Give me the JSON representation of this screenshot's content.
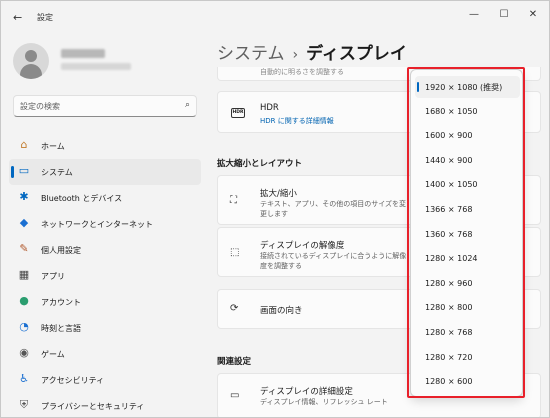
{
  "window": {
    "title": "設定",
    "back_icon": "←",
    "minimize": "—",
    "maximize": "☐",
    "close": "✕"
  },
  "search": {
    "placeholder": "設定の検索",
    "icon": "⌕"
  },
  "sidebar": {
    "items": [
      {
        "label": "ホーム",
        "icon": "⌂",
        "color": "#c27b2c"
      },
      {
        "label": "システム",
        "icon": "▭",
        "color": "#0067c0"
      },
      {
        "label": "Bluetooth とデバイス",
        "icon": "✱",
        "color": "#0067c0"
      },
      {
        "label": "ネットワークとインターネット",
        "icon": "◆",
        "color": "#1a6fd1"
      },
      {
        "label": "個人用設定",
        "icon": "✎",
        "color": "#b0572a"
      },
      {
        "label": "アプリ",
        "icon": "▦",
        "color": "#444444"
      },
      {
        "label": "アカウント",
        "icon": "●",
        "color": "#2a9d6f"
      },
      {
        "label": "時刻と言語",
        "icon": "◔",
        "color": "#1a6fd1"
      },
      {
        "label": "ゲーム",
        "icon": "◉",
        "color": "#555555"
      },
      {
        "label": "アクセシビリティ",
        "icon": "♿",
        "color": "#1a6fd1"
      },
      {
        "label": "プライバシーとセキュリティ",
        "icon": "⛨",
        "color": "#555555"
      }
    ]
  },
  "breadcrumb": {
    "parent": "システム",
    "separator": "›",
    "current": "ディスプレイ"
  },
  "main": {
    "partial_text": "自動的に明るさを調整する",
    "hdr": {
      "badge": "HDR",
      "title": "HDR",
      "link": "HDR に関する詳細情報"
    },
    "scale_section_title": "拡大縮小とレイアウト",
    "scale": {
      "icon": "⛶",
      "title": "拡大/縮小",
      "sub": "テキスト、アプリ、その他の項目のサイズを変更します"
    },
    "resolution": {
      "icon": "⬚",
      "title": "ディスプレイの解像度",
      "sub": "接続されているディスプレイに合うように解像度を調整する"
    },
    "orientation": {
      "icon": "⟳",
      "title": "画面の向き"
    },
    "related_section_title": "関連設定",
    "advanced": {
      "icon": "▭",
      "title": "ディスプレイの詳細設定",
      "sub": "ディスプレイ情報、リフレッシュ レート"
    }
  },
  "dropdown": {
    "selected_index": 0,
    "options": [
      "1920 × 1080 (推奨)",
      "1680 × 1050",
      "1600 × 900",
      "1440 × 900",
      "1400 × 1050",
      "1366 × 768",
      "1360 × 768",
      "1280 × 1024",
      "1280 × 960",
      "1280 × 800",
      "1280 × 768",
      "1280 × 720",
      "1280 × 600"
    ]
  }
}
